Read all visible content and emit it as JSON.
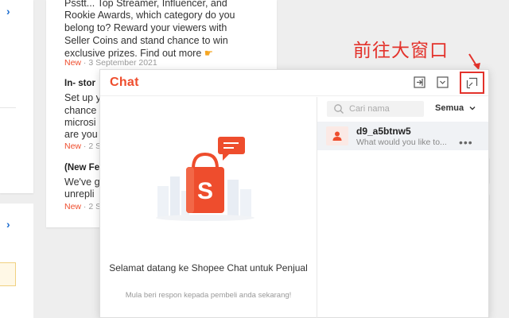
{
  "annotation": {
    "text": "前往大窗口"
  },
  "news": {
    "item1": {
      "lines": [
        "Psstt... Top Streamer, Influencer, and",
        "Rookie Awards, which category do you",
        "belong to? Reward your viewers with",
        "Seller Coins and stand chance to win",
        "exclusive prizes. Find out more"
      ],
      "new_label": "New",
      "date": " · 3 September 2021"
    },
    "item2": {
      "title": "In- stor",
      "lines": [
        "Set up y",
        "chance",
        "microsi",
        "are you"
      ],
      "new_label": "New",
      "date": " · 2 S"
    },
    "item3": {
      "title": "(New Fe",
      "lines": [
        "We've g",
        "unrepli"
      ],
      "new_label": "New",
      "date": " · 2 S"
    }
  },
  "chat": {
    "title": "Chat",
    "empty_title": "Selamat datang ke Shopee Chat untuk Penjual",
    "empty_subtitle": "Mula beri respon kepada pembeli anda sekarang!",
    "search_placeholder": "Cari nama",
    "filter_label": "Semua",
    "conversations": [
      {
        "name": "d9_a5btnw5",
        "preview": "What would you like to...",
        "more": "•••"
      }
    ],
    "colors": {
      "brand": "#ee4d2d",
      "annotation": "#e3322b"
    }
  },
  "icons": {
    "chevron": "›"
  }
}
